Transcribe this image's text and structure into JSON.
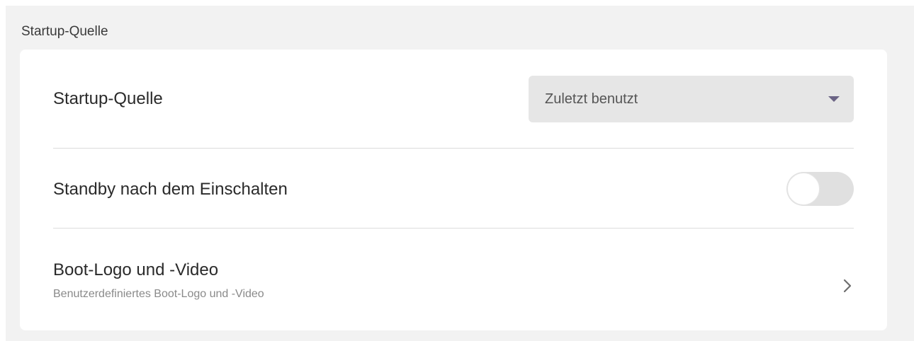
{
  "section": {
    "title": "Startup-Quelle"
  },
  "rows": [
    {
      "label": "Startup-Quelle",
      "control": "dropdown",
      "dropdown_value": "Zuletzt benutzt",
      "icon": "caret-down-icon"
    },
    {
      "label": "Standby nach dem Einschalten",
      "control": "toggle",
      "toggle_state": "off"
    },
    {
      "label": "Boot-Logo und -Video",
      "subtitle": "Benutzerdefiniertes Boot-Logo und -Video",
      "control": "navigate",
      "icon": "chevron-right-icon"
    }
  ],
  "colors": {
    "page_background": "#f2f2f2",
    "card_background": "#ffffff",
    "dropdown_background": "#e6e6e6",
    "dropdown_arrow": "#6a6384",
    "toggle_track_off": "#e0e0e0",
    "divider": "#dcdcdc"
  }
}
